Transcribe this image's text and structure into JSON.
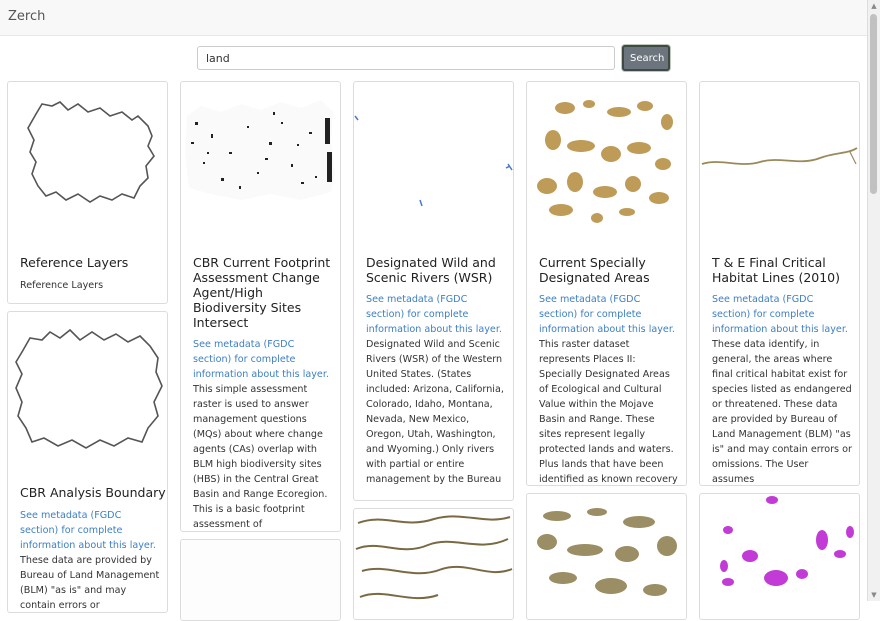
{
  "app": {
    "brand": "Zerch"
  },
  "search": {
    "value": "land",
    "button_label": "Search"
  },
  "cards": [
    {
      "title": "Reference Layers",
      "text": "Reference Layers"
    },
    {
      "title": "CBR Analysis Boundary",
      "link": "See metadata (FGDC section) for complete information about this layer.",
      "text": "These data are provided by Bureau of Land Management (BLM) \"as is\" and may contain errors or"
    },
    {
      "title": "CBR Current Footprint Assessment Change Agent/High Biodiversity Sites Intersect",
      "link": "See metadata (FGDC section) for complete information about this layer.",
      "text": "This simple assessment raster is used to answer management questions (MQs) about where change agents (CAs) overlap with BLM high biodiversity sites (HBS) in the Central Great Basin and Range Ecoregion. This is a basic footprint assessment of"
    },
    {
      "title": "Designated Wild and Scenic Rivers (WSR)",
      "link": "See metadata (FGDC section) for complete information about this layer.",
      "text": "Designated Wild and Scenic Rivers (WSR) of the Western United States. (States included: Arizona, California, Colorado, Idaho, Montana, Nevada, New Mexico, Oregon, Utah, Washington, and Wyoming.) Only rivers with partial or entire management by the Bureau"
    },
    {
      "title": "Current Specially Designated Areas",
      "link": "See metadata (FGDC section) for complete information about this layer.",
      "text": "This raster dataset represents Places II: Specially Designated Areas of Ecological and Cultural Value within the Mojave Basin and Range. These sites represent legally protected lands and waters. Plus lands that have been identified as known recovery lands"
    },
    {
      "title": "T & E Final Critical Habitat Lines (2010)",
      "link": "See metadata (FGDC section) for complete information about this layer.",
      "text": "These data identify, in general, the areas where final critical habitat exist for species listed as endangered or threatened. These data are provided by Bureau of Land Management (BLM) \"as is\" and may contain errors or omissions. The User assumes"
    }
  ],
  "colors": {
    "link": "#3d7fc2",
    "button": "#6c757d",
    "habitat": "#b48a3c",
    "magenta": "#c23bd6"
  }
}
